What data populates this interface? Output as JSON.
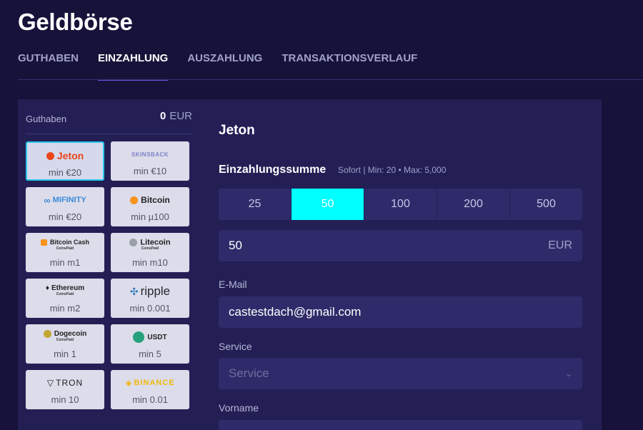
{
  "title": "Geldbörse",
  "tabs": [
    {
      "label": "GUTHABEN"
    },
    {
      "label": "EINZAHLUNG"
    },
    {
      "label": "AUSZAHLUNG"
    },
    {
      "label": "TRANSAKTIONSVERLAUF"
    }
  ],
  "active_tab": "EINZAHLUNG",
  "balance": {
    "label": "Guthaben",
    "value": "0",
    "currency": "EUR"
  },
  "methods": [
    {
      "name": "Jeton",
      "min": "min €20",
      "selected": true,
      "color": "#e8451b"
    },
    {
      "name": "SKINSBACK",
      "min": "min €10",
      "color": "#7d83c9"
    },
    {
      "name": "MIFINITY",
      "min": "min €20",
      "color": "#3a8ad8"
    },
    {
      "name": "Bitcoin",
      "min": "min µ100",
      "color": "#f7931a"
    },
    {
      "name": "Bitcoin Cash",
      "min": "min m1",
      "color": "#f7931a"
    },
    {
      "name": "Litecoin",
      "min": "min m10",
      "color": "#9aa0a6"
    },
    {
      "name": "Ethereum",
      "min": "min m2",
      "color": "#3c3c3d"
    },
    {
      "name": "ripple",
      "min": "min 0.001",
      "color": "#23292f"
    },
    {
      "name": "Dogecoin",
      "min": "min 1",
      "color": "#c2a633"
    },
    {
      "name": "USDT",
      "min": "min 5",
      "color": "#26a17b"
    },
    {
      "name": "TRON",
      "min": "min 10",
      "color": "#222222"
    },
    {
      "name": "BINANCE",
      "min": "min 0.01",
      "color": "#f0b90b"
    }
  ],
  "coinspaid_label": "CoinsPaid",
  "form": {
    "title": "Jeton",
    "amount_label": "Einzahlungssumme",
    "amount_hint": "Sofort | Min: 20 • Max: 5,000",
    "amount_options": [
      "25",
      "50",
      "100",
      "200",
      "500"
    ],
    "selected_amount": "50",
    "amount_value": "50",
    "amount_currency": "EUR",
    "email_label": "E-Mail",
    "email_value": "castestdach@gmail.com",
    "service_label": "Service",
    "service_placeholder": "Service",
    "firstname_label": "Vorname"
  },
  "colors": {
    "accent": "#00ffff",
    "tab_underline": "#6c53e4",
    "background": "#16123a",
    "panel": "#231f55"
  }
}
